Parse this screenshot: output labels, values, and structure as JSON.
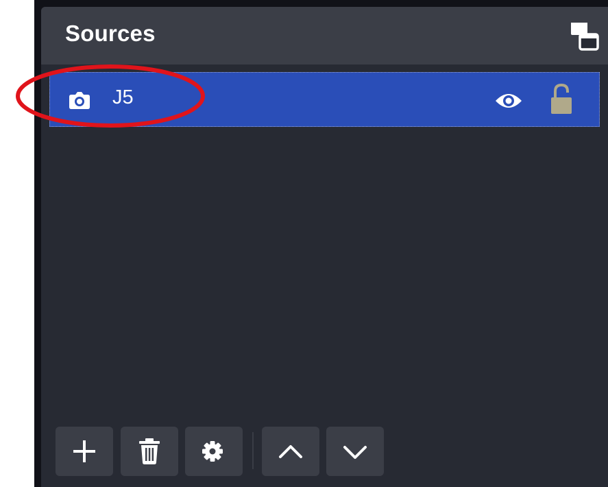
{
  "panel": {
    "title": "Sources",
    "undock_icon": "undock-windows-icon"
  },
  "sources": [
    {
      "name": "J5",
      "type_icon": "camera-icon",
      "visible": true,
      "visibility_icon": "eye-icon",
      "locked": false,
      "lock_icon": "unlocked-padlock-icon",
      "selected": true
    }
  ],
  "toolbar": {
    "buttons": [
      {
        "icon": "plus-icon"
      },
      {
        "icon": "trash-icon"
      },
      {
        "icon": "gear-icon"
      },
      {
        "icon": "chevron-up-icon"
      },
      {
        "icon": "chevron-down-icon"
      }
    ]
  },
  "annotation": {
    "shape": "ellipse",
    "color": "#e0141b"
  },
  "colors": {
    "panel_bg": "#272a33",
    "header_bg": "#3b3e47",
    "selected_row": "#2a4eb8",
    "lock_icon": "#b0a98a",
    "annotation": "#e0141b"
  }
}
